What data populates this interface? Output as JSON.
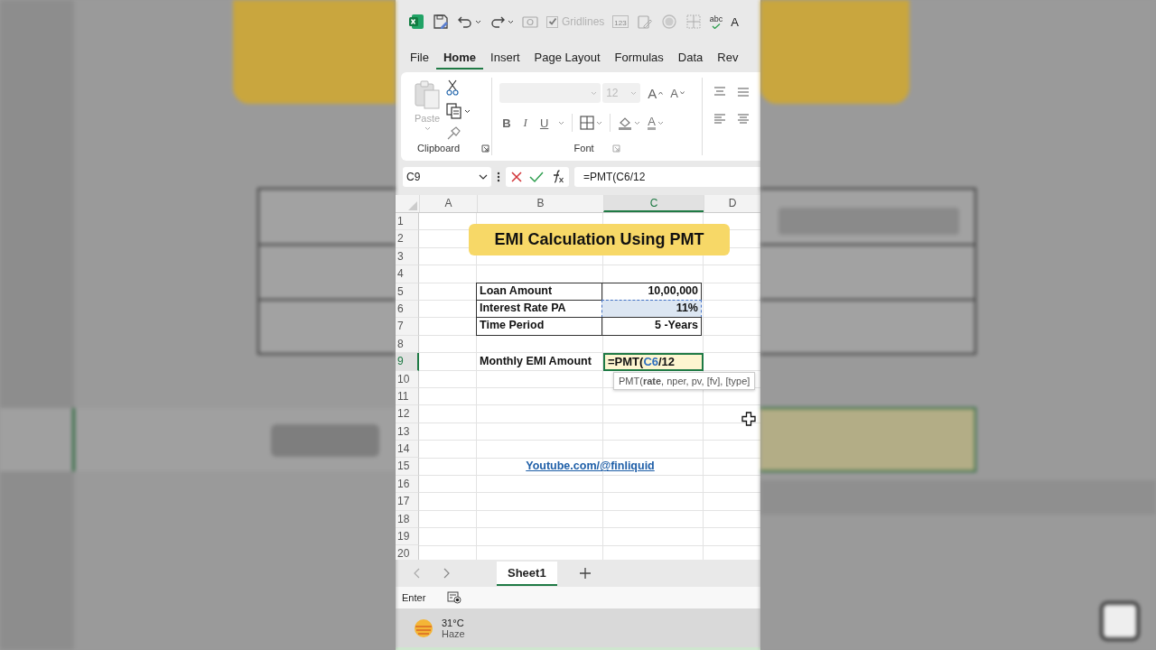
{
  "quick_access": [
    {
      "kind": "logo"
    },
    {
      "kind": "save"
    },
    {
      "kind": "undo"
    },
    {
      "kind": "redo"
    },
    {
      "kind": "camera"
    },
    {
      "kind": "checkbox",
      "label": "Gridlines",
      "checked": true,
      "disabled": true
    },
    {
      "kind": "number-format",
      "label": "123"
    },
    {
      "kind": "edit"
    },
    {
      "kind": "circle"
    },
    {
      "kind": "borders"
    },
    {
      "kind": "spelling",
      "label": "abc"
    },
    {
      "kind": "text",
      "label": "A"
    }
  ],
  "tabs": [
    {
      "label": "File",
      "selected": false
    },
    {
      "label": "Home",
      "selected": true
    },
    {
      "label": "Insert",
      "selected": false
    },
    {
      "label": "Page Layout",
      "selected": false
    },
    {
      "label": "Formulas",
      "selected": false
    },
    {
      "label": "Data",
      "selected": false
    },
    {
      "label": "Rev",
      "selected": false
    }
  ],
  "ribbon": {
    "clipboard": {
      "paste_label": "Paste",
      "group_label": "Clipboard"
    },
    "font": {
      "size": "12",
      "grow": "A",
      "shrink": "A",
      "format_buttons": [
        {
          "kind": "bold",
          "label": "B"
        },
        {
          "kind": "italic",
          "label": "I"
        },
        {
          "kind": "underline",
          "label": "U"
        }
      ],
      "font_color": "A",
      "group_label": "Font"
    }
  },
  "formula_bar": {
    "name_box": "C9",
    "formula": "=PMT(C6/12"
  },
  "columns": [
    {
      "label": "A",
      "selected": false
    },
    {
      "label": "B",
      "selected": false
    },
    {
      "label": "C",
      "selected": true
    },
    {
      "label": "D",
      "selected": false
    }
  ],
  "rows": [
    {
      "number": "1",
      "selected": false
    },
    {
      "number": "2",
      "selected": false
    },
    {
      "number": "3",
      "selected": false
    },
    {
      "number": "4",
      "selected": false
    },
    {
      "number": "5",
      "selected": false,
      "column_b": {
        "text": "Loan Amount",
        "kind": "label",
        "bordered": true
      },
      "column_c": {
        "text": "10,00,000",
        "kind": "value",
        "bordered": true
      }
    },
    {
      "number": "6",
      "selected": false,
      "column_b": {
        "text": "Interest Rate PA",
        "kind": "label",
        "bordered": true
      },
      "column_c": {
        "text": "11%",
        "kind": "value",
        "bordered": true,
        "highlighted": true
      }
    },
    {
      "number": "7",
      "selected": false,
      "column_b": {
        "text": "Time Period",
        "kind": "label",
        "bordered": true
      },
      "column_c": {
        "text": "5 -Years",
        "kind": "value",
        "bordered": true
      }
    },
    {
      "number": "8",
      "selected": false
    },
    {
      "number": "9",
      "selected": true,
      "column_b": {
        "text": "Monthly EMI Amount",
        "kind": "label"
      },
      "column_c": {
        "kind": "editing",
        "parts": [
          {
            "text": "=PMT(",
            "kind": "plain"
          },
          {
            "text": "C6",
            "kind": "reference"
          },
          {
            "text": "/12",
            "kind": "plain"
          }
        ]
      }
    },
    {
      "number": "10",
      "selected": false
    },
    {
      "number": "11",
      "selected": false
    },
    {
      "number": "12",
      "selected": false
    },
    {
      "number": "13",
      "selected": false
    },
    {
      "number": "14",
      "selected": false
    },
    {
      "number": "15",
      "selected": false,
      "column_b": {
        "text": "Youtube.com/@finliquid",
        "kind": "merged-link"
      }
    },
    {
      "number": "16",
      "selected": false
    },
    {
      "number": "17",
      "selected": false
    },
    {
      "number": "18",
      "selected": false
    },
    {
      "number": "19",
      "selected": false
    },
    {
      "number": "20",
      "selected": false
    }
  ],
  "title_banner": "EMI Calculation Using PMT",
  "tooltip": "PMT(**rate**, nper, pv, [fv], [type]",
  "sheet_tabs": [
    {
      "label": "Sheet1",
      "selected": true
    }
  ],
  "status_bar": {
    "mode": "Enter"
  },
  "taskbar": {
    "temperature": "31°C",
    "condition": "Haze"
  }
}
